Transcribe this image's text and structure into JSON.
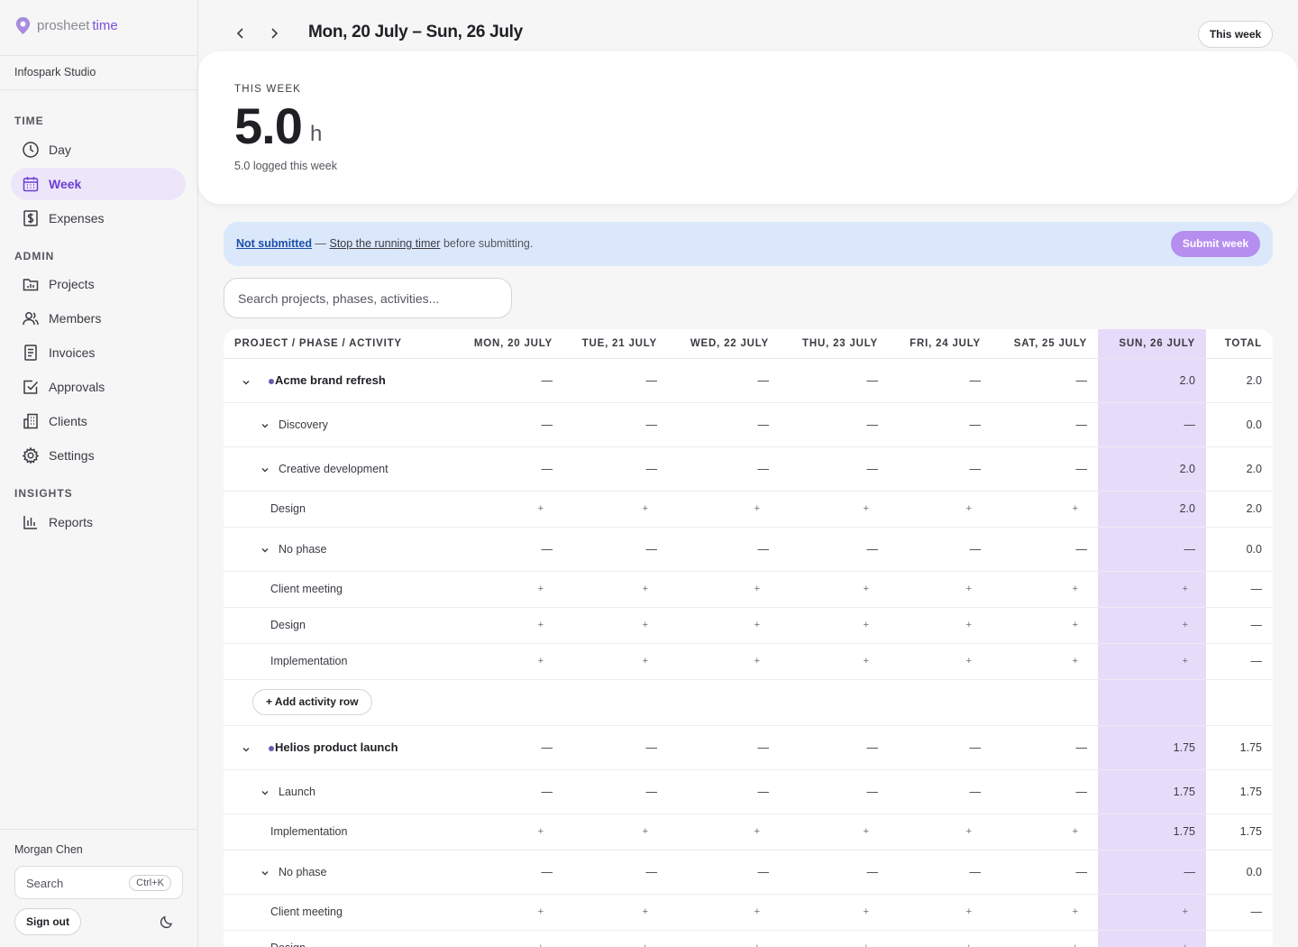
{
  "brand": {
    "name_plain": "prosheet",
    "name_accent": "time"
  },
  "org": "Infospark Studio",
  "sidebar": {
    "sections": [
      {
        "label": "TIME"
      },
      {
        "label": "ADMIN"
      },
      {
        "label": "INSIGHTS"
      }
    ],
    "items": [
      {
        "label": "Day",
        "icon": "clock-icon"
      },
      {
        "label": "Week",
        "icon": "calendar-icon",
        "active": true
      },
      {
        "label": "Expenses",
        "icon": "dollar-receipt-icon"
      },
      {
        "label": "Projects",
        "icon": "folder-icon"
      },
      {
        "label": "Members",
        "icon": "users-icon"
      },
      {
        "label": "Invoices",
        "icon": "invoice-icon"
      },
      {
        "label": "Approvals",
        "icon": "check-square-icon"
      },
      {
        "label": "Clients",
        "icon": "building-icon"
      },
      {
        "label": "Settings",
        "icon": "gear-icon"
      },
      {
        "label": "Reports",
        "icon": "bar-chart-icon"
      }
    ],
    "user": "Morgan Chen",
    "search_label": "Search",
    "search_kbd": "Ctrl+K",
    "signout": "Sign out"
  },
  "header": {
    "prev": "‹",
    "next": "›",
    "title": "Mon, 20 July – Sun, 26 July",
    "this_week": "This week"
  },
  "summary": {
    "label": "THIS WEEK",
    "value": "5.0",
    "unit": "h",
    "sub": "5.0 logged this week"
  },
  "banner": {
    "status": "Not submitted",
    "sep": " — ",
    "link": "Stop the running timer",
    "rest": " before submitting.",
    "submit": "Submit week"
  },
  "search_placeholder": "Search projects, phases, activities...",
  "table": {
    "headers": [
      "PROJECT / PHASE / ACTIVITY",
      "MON, 20 JULY",
      "TUE, 21 JULY",
      "WED, 22 JULY",
      "THU, 23 JULY",
      "FRI, 24 JULY",
      "SAT, 25 JULY",
      "SUN, 26 JULY",
      "TOTAL"
    ],
    "dash": "—",
    "plus": "+",
    "add_row": "+ Add activity row",
    "rows": [
      {
        "type": "project",
        "name": "Acme brand refresh",
        "cells": [
          "—",
          "—",
          "—",
          "—",
          "—",
          "—",
          "2.0"
        ],
        "total": "2.0"
      },
      {
        "type": "phase",
        "name": "Discovery",
        "cells": [
          "—",
          "—",
          "—",
          "—",
          "—",
          "—",
          "—"
        ],
        "total": "0.0"
      },
      {
        "type": "phase",
        "name": "Creative development",
        "cells": [
          "—",
          "—",
          "—",
          "—",
          "—",
          "—",
          "2.0"
        ],
        "total": "2.0"
      },
      {
        "type": "activity",
        "name": "Design",
        "cells": [
          "+",
          "+",
          "+",
          "+",
          "+",
          "+",
          "2.0"
        ],
        "total": "2.0"
      },
      {
        "type": "phase",
        "name": "No phase",
        "cells": [
          "—",
          "—",
          "—",
          "—",
          "—",
          "—",
          "—"
        ],
        "total": "0.0"
      },
      {
        "type": "activity",
        "name": "Client meeting",
        "cells": [
          "+",
          "+",
          "+",
          "+",
          "+",
          "+",
          "+"
        ],
        "total": "—"
      },
      {
        "type": "activity",
        "name": "Design",
        "cells": [
          "+",
          "+",
          "+",
          "+",
          "+",
          "+",
          "+"
        ],
        "total": "—"
      },
      {
        "type": "activity",
        "name": "Implementation",
        "cells": [
          "+",
          "+",
          "+",
          "+",
          "+",
          "+",
          "+"
        ],
        "total": "—"
      },
      {
        "type": "add"
      },
      {
        "type": "project",
        "name": "Helios product launch",
        "cells": [
          "—",
          "—",
          "—",
          "—",
          "—",
          "—",
          "1.75"
        ],
        "total": "1.75"
      },
      {
        "type": "phase",
        "name": "Launch",
        "cells": [
          "—",
          "—",
          "—",
          "—",
          "—",
          "—",
          "1.75"
        ],
        "total": "1.75"
      },
      {
        "type": "activity",
        "name": "Implementation",
        "cells": [
          "+",
          "+",
          "+",
          "+",
          "+",
          "+",
          "1.75"
        ],
        "total": "1.75"
      },
      {
        "type": "phase",
        "name": "No phase",
        "cells": [
          "—",
          "—",
          "—",
          "—",
          "—",
          "—",
          "—"
        ],
        "total": "0.0"
      },
      {
        "type": "activity",
        "name": "Client meeting",
        "cells": [
          "+",
          "+",
          "+",
          "+",
          "+",
          "+",
          "+"
        ],
        "total": "—"
      },
      {
        "type": "activity",
        "name": "Design",
        "cells": [
          "+",
          "+",
          "+",
          "+",
          "+",
          "+",
          "+"
        ],
        "total": "—"
      }
    ]
  }
}
